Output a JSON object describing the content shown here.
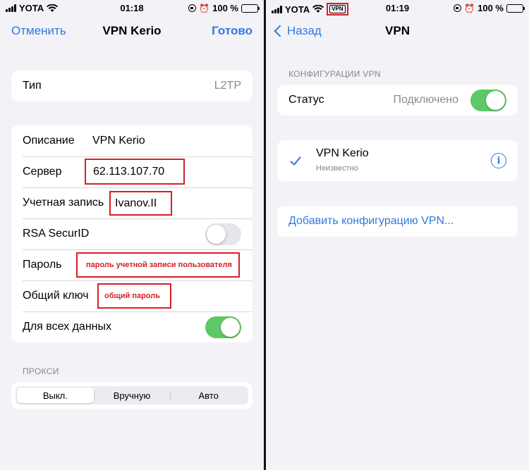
{
  "left": {
    "status": {
      "carrier": "YOTA",
      "time": "01:18",
      "battery": "100 %"
    },
    "nav": {
      "cancel": "Отменить",
      "title": "VPN Kerio",
      "done": "Готово"
    },
    "type": {
      "label": "Тип",
      "value": "L2TP"
    },
    "fields": {
      "description": {
        "label": "Описание",
        "value": "VPN Kerio"
      },
      "server": {
        "label": "Сервер",
        "value": "62.113.107.70"
      },
      "account": {
        "label": "Учетная запись",
        "value": "Ivanov.II"
      },
      "rsa": {
        "label": "RSA SecurID",
        "on": false
      },
      "password": {
        "label": "Пароль",
        "annotation": "пароль учетной записи пользователя"
      },
      "shared_key": {
        "label": "Общий ключ",
        "annotation": "общий пароль"
      },
      "all_data": {
        "label": "Для всех данных",
        "on": true
      }
    },
    "proxy": {
      "header": "ПРОКСИ",
      "options": [
        "Выкл.",
        "Вручную",
        "Авто"
      ],
      "selected": "Выкл."
    }
  },
  "right": {
    "status": {
      "carrier": "YOTA",
      "vpn": "VPN",
      "time": "01:19",
      "battery": "100 %"
    },
    "nav": {
      "back": "Назад",
      "title": "VPN"
    },
    "config_header": "КОНФИГУРАЦИИ VPN",
    "status_row": {
      "label": "Статус",
      "value": "Подключено",
      "on": true
    },
    "vpn_item": {
      "name": "VPN Kerio",
      "sub": "Неизвестно"
    },
    "add_config": "Добавить конфигурацию VPN..."
  },
  "colors": {
    "accent": "#2f7bdf",
    "toggle_on": "#5fc866",
    "annotation_red": "#d61f26",
    "background": "#f2f2f7"
  }
}
